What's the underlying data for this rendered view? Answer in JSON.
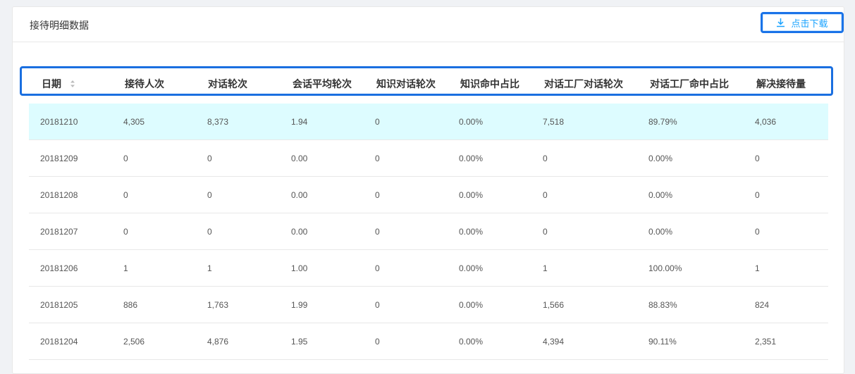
{
  "header": {
    "title": "接待明细数据",
    "download_label": "点击下载"
  },
  "table": {
    "columns": [
      "日期",
      "接待人次",
      "对话轮次",
      "会话平均轮次",
      "知识对话轮次",
      "知识命中占比",
      "对话工厂对话轮次",
      "对话工厂命中占比",
      "解决接待量"
    ],
    "rows": [
      [
        "20181210",
        "4,305",
        "8,373",
        "1.94",
        "0",
        "0.00%",
        "7,518",
        "89.79%",
        "4,036"
      ],
      [
        "20181209",
        "0",
        "0",
        "0.00",
        "0",
        "0.00%",
        "0",
        "0.00%",
        "0"
      ],
      [
        "20181208",
        "0",
        "0",
        "0.00",
        "0",
        "0.00%",
        "0",
        "0.00%",
        "0"
      ],
      [
        "20181207",
        "0",
        "0",
        "0.00",
        "0",
        "0.00%",
        "0",
        "0.00%",
        "0"
      ],
      [
        "20181206",
        "1",
        "1",
        "1.00",
        "0",
        "0.00%",
        "1",
        "100.00%",
        "1"
      ],
      [
        "20181205",
        "886",
        "1,763",
        "1.99",
        "0",
        "0.00%",
        "1,566",
        "88.83%",
        "824"
      ],
      [
        "20181204",
        "2,506",
        "4,876",
        "1.95",
        "0",
        "0.00%",
        "4,394",
        "90.11%",
        "2,351"
      ]
    ],
    "highlight_color": "#ddfcff",
    "accent_color": "#1aa3ff"
  }
}
